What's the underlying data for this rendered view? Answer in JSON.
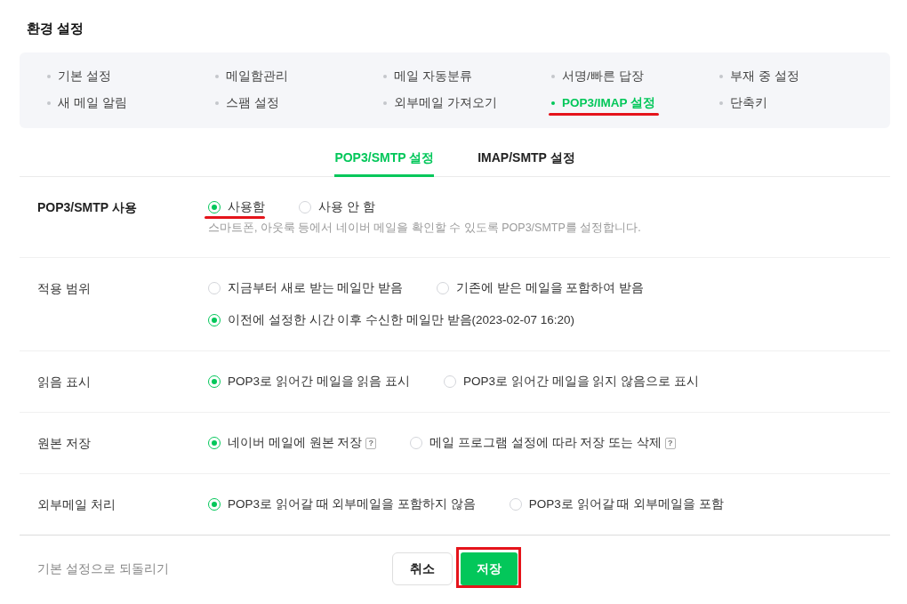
{
  "title": "환경 설정",
  "menu": [
    {
      "label": "기본 설정",
      "selected": false,
      "annotated": false
    },
    {
      "label": "메일함관리",
      "selected": false,
      "annotated": false
    },
    {
      "label": "메일 자동분류",
      "selected": false,
      "annotated": false
    },
    {
      "label": "서명/빠른 답장",
      "selected": false,
      "annotated": false
    },
    {
      "label": "부재 중 설정",
      "selected": false,
      "annotated": false
    },
    {
      "label": "새 메일 알림",
      "selected": false,
      "annotated": false
    },
    {
      "label": "스팸 설정",
      "selected": false,
      "annotated": false
    },
    {
      "label": "외부메일 가져오기",
      "selected": false,
      "annotated": false
    },
    {
      "label": "POP3/IMAP 설정",
      "selected": true,
      "annotated": true
    },
    {
      "label": "단축키",
      "selected": false,
      "annotated": false
    }
  ],
  "tabs": [
    {
      "label": "POP3/SMTP 설정",
      "selected": true
    },
    {
      "label": "IMAP/SMTP 설정",
      "selected": false
    }
  ],
  "settings": [
    {
      "label": "POP3/SMTP 사용",
      "emphasized": true,
      "options": [
        {
          "label": "사용함",
          "selected": true,
          "annotated": true
        },
        {
          "label": "사용 안 함",
          "selected": false,
          "annotated": false
        }
      ],
      "description": "스마트폰, 아웃룩 등에서 네이버 메일을 확인할 수 있도록 POP3/SMTP를 설정합니다."
    },
    {
      "label": "적용 범위",
      "emphasized": false,
      "options": [
        {
          "label": "지금부터 새로 받는 메일만 받음",
          "selected": false,
          "annotated": false
        },
        {
          "label": "기존에 받은 메일을 포함하여 받음",
          "selected": false,
          "annotated": false
        },
        {
          "label": "이전에 설정한 시간 이후 수신한 메일만 받음(2023-02-07 16:20)",
          "selected": true,
          "annotated": false
        }
      ]
    },
    {
      "label": "읽음 표시",
      "emphasized": false,
      "options": [
        {
          "label": "POP3로 읽어간 메일을 읽음 표시",
          "selected": true,
          "annotated": false
        },
        {
          "label": "POP3로 읽어간 메일을 읽지 않음으로 표시",
          "selected": false,
          "annotated": false
        }
      ]
    },
    {
      "label": "원본 저장",
      "emphasized": false,
      "options": [
        {
          "label": "네이버 메일에 원본 저장",
          "selected": true,
          "annotated": false,
          "help": "?"
        },
        {
          "label": "메일 프로그램 설정에 따라 저장 또는 삭제",
          "selected": false,
          "annotated": false,
          "help": "?"
        }
      ]
    },
    {
      "label": "외부메일 처리",
      "emphasized": false,
      "options": [
        {
          "label": "POP3로 읽어갈 때 외부메일을 포함하지 않음",
          "selected": true,
          "annotated": false
        },
        {
          "label": "POP3로 읽어갈 때 외부메일을 포함",
          "selected": false,
          "annotated": false
        }
      ]
    }
  ],
  "footer": {
    "reset_link": "기본 설정으로 되돌리기",
    "buttons": [
      {
        "label": "취소",
        "kind": "secondary",
        "annotated": false
      },
      {
        "label": "저장",
        "kind": "primary",
        "annotated": true
      }
    ]
  }
}
